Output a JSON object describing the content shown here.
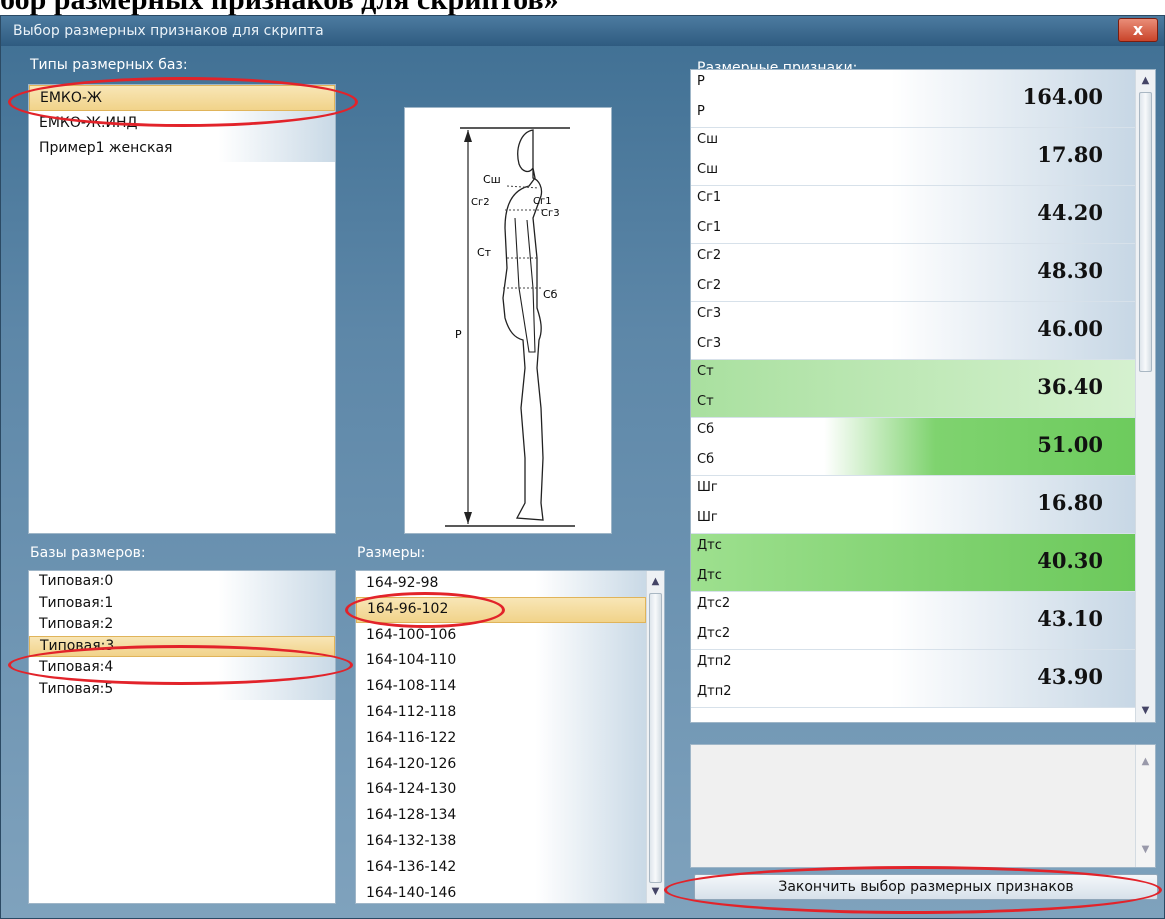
{
  "doc_heading": "бор размерных признаков для скриптов»",
  "window": {
    "title": "Выбор размерных признаков для скрипта",
    "close_label": "x"
  },
  "base_types": {
    "label": "Типы размерных баз:",
    "items": [
      "ЕМКО-Ж",
      "ЕМКО-Ж.ИНД",
      "Пример1 женская"
    ],
    "selected": "ЕМКО-Ж"
  },
  "size_bases": {
    "label": "Базы размеров:",
    "items": [
      "Типовая:0",
      "Типовая:1",
      "Типовая:2",
      "Типовая:3",
      "Типовая:4",
      "Типовая:5"
    ],
    "selected": "Типовая:3"
  },
  "sizes": {
    "label": "Размеры:",
    "items": [
      "164-92-98",
      "164-96-102",
      "164-100-106",
      "164-104-110",
      "164-108-114",
      "164-112-118",
      "164-116-122",
      "164-120-126",
      "164-124-130",
      "164-128-134",
      "164-132-138",
      "164-136-142",
      "164-140-146"
    ],
    "selected": "164-96-102"
  },
  "figure_labels": [
    "Сш",
    "Сг2",
    "Сг1",
    "Сг3",
    "Ст",
    "Сб",
    "Р"
  ],
  "measurements": {
    "label": "Размерные признаки:",
    "rows": [
      {
        "code": "Р",
        "name": "Р",
        "value": "164.00",
        "highlight": "none"
      },
      {
        "code": "Сш",
        "name": "Сш",
        "value": "17.80",
        "highlight": "none"
      },
      {
        "code": "Сг1",
        "name": "Сг1",
        "value": "44.20",
        "highlight": "none"
      },
      {
        "code": "Сг2",
        "name": "Сг2",
        "value": "48.30",
        "highlight": "none"
      },
      {
        "code": "Сг3",
        "name": "Сг3",
        "value": "46.00",
        "highlight": "none"
      },
      {
        "code": "Ст",
        "name": "Ст",
        "value": "36.40",
        "highlight": "green"
      },
      {
        "code": "Сб",
        "name": "Сб",
        "value": "51.00",
        "highlight": "green"
      },
      {
        "code": "Шг",
        "name": "Шг",
        "value": "16.80",
        "highlight": "none"
      },
      {
        "code": "Дтс",
        "name": "Дтс",
        "value": "40.30",
        "highlight": "green"
      },
      {
        "code": "Дтс2",
        "name": "Дтс2",
        "value": "43.10",
        "highlight": "none"
      },
      {
        "code": "Дтп2",
        "name": "Дтп2",
        "value": "43.90",
        "highlight": "none"
      }
    ]
  },
  "finish_button": {
    "label": "Закончить выбор размерных признаков"
  },
  "colors": {
    "selection": "#f1d38a",
    "highlight_green": "#7ed16e",
    "annotation_red": "#e2232a",
    "window_blue": "#3f6f93"
  }
}
